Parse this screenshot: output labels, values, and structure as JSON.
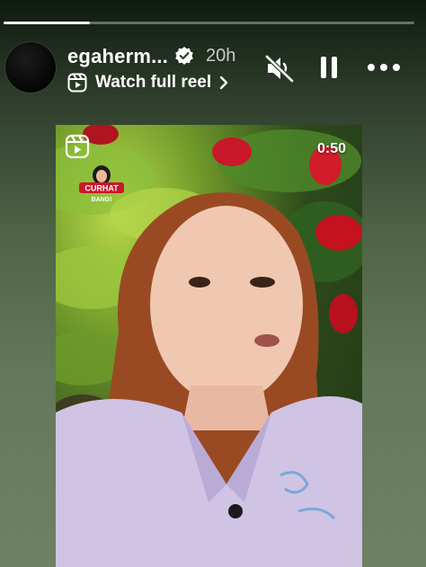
{
  "story": {
    "progress": 0.21
  },
  "header": {
    "username": "egaherm...",
    "timestamp": "20h",
    "watch_reel_label": "Watch full reel"
  },
  "video": {
    "duration": "0:50",
    "channel_logo_text": "CURHAT BANG!"
  },
  "icons": {
    "verified": "verified-badge-icon",
    "reel": "reel-icon",
    "chevron": "chevron-right-icon",
    "mute": "speaker-muted-icon",
    "pause": "pause-icon",
    "more": "more-options-icon"
  },
  "colors": {
    "accent_red": "#c8182a",
    "text": "#ffffff"
  }
}
